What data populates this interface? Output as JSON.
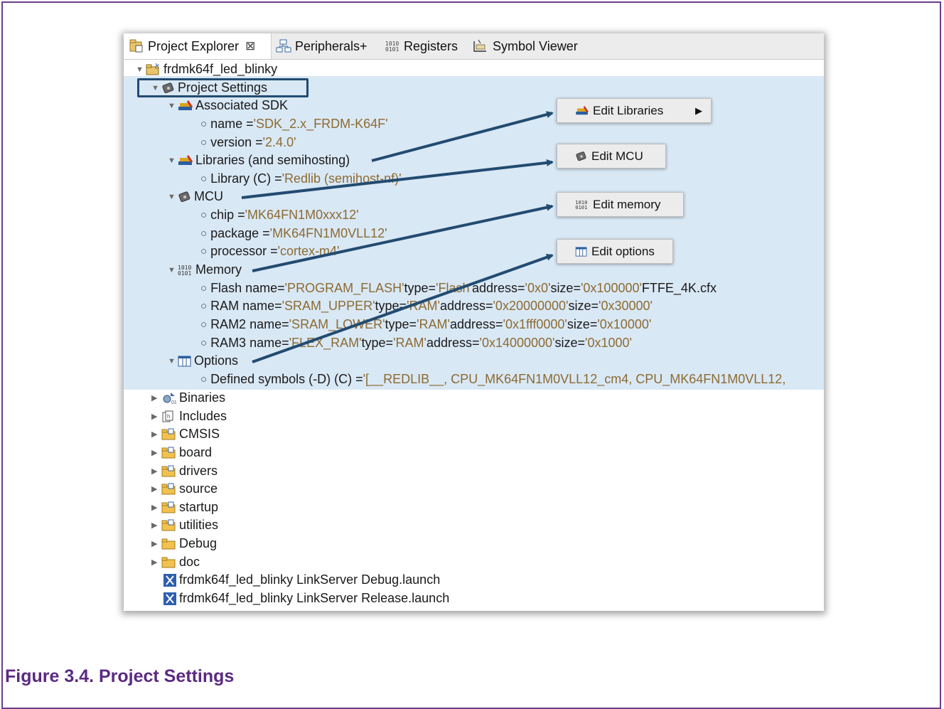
{
  "tabs": [
    {
      "label": "Project Explorer",
      "close": "⊠",
      "icon": "project-explorer-icon"
    },
    {
      "label": "Peripherals+",
      "icon": "peripherals-icon"
    },
    {
      "label": "Registers",
      "icon": "registers-icon"
    },
    {
      "label": "Symbol Viewer",
      "icon": "symbol-viewer-icon"
    }
  ],
  "tree": {
    "project": "frdmk64f_led_blinky",
    "project_settings": "Project Settings",
    "sdk": {
      "label": "Associated SDK",
      "name_key": "name = ",
      "name_val": "'SDK_2.x_FRDM-K64F'",
      "version_key": "version = ",
      "version_val": "'2.4.0'"
    },
    "libraries": {
      "label": "Libraries (and semihosting)",
      "lib_key": "Library (C) = ",
      "lib_val": "'Redlib (semihost-nf)'"
    },
    "mcu": {
      "label": "MCU",
      "chip_key": "chip = ",
      "chip_val": "'MK64FN1M0xxx12'",
      "package_key": "package = ",
      "package_val": "'MK64FN1M0VLL12'",
      "processor_key": "processor = ",
      "processor_val": "'cortex-m4'"
    },
    "memory": {
      "label": "Memory",
      "items": [
        {
          "p1": "Flash name=",
          "v1": "'PROGRAM_FLASH'",
          "p2": " type=",
          "v2": "'Flash'",
          "p3": " address=",
          "v3": "'0x0'",
          "p4": " size=",
          "v4": "'0x100000'",
          "p5": " FTFE_4K.cfx"
        },
        {
          "p1": "RAM name=",
          "v1": "'SRAM_UPPER'",
          "p2": " type=",
          "v2": "'RAM'",
          "p3": " address=",
          "v3": "'0x20000000'",
          "p4": " size=",
          "v4": "'0x30000'",
          "p5": ""
        },
        {
          "p1": "RAM2 name=",
          "v1": "'SRAM_LOWER'",
          "p2": " type=",
          "v2": "'RAM'",
          "p3": " address=",
          "v3": "'0x1fff0000'",
          "p4": " size=",
          "v4": "'0x10000'",
          "p5": ""
        },
        {
          "p1": "RAM3 name=",
          "v1": "'FLEX_RAM'",
          "p2": " type=",
          "v2": "'RAM'",
          "p3": " address=",
          "v3": "'0x14000000'",
          "p4": " size=",
          "v4": "'0x1000'",
          "p5": ""
        }
      ]
    },
    "options": {
      "label": "Options",
      "defined_key": "Defined symbols (-D) (C) = ",
      "defined_val": "'[__REDLIB__, CPU_MK64FN1M0VLL12_cm4, CPU_MK64FN1M0VLL12,"
    },
    "folders": [
      "Binaries",
      "Includes",
      "CMSIS",
      "board",
      "drivers",
      "source",
      "startup",
      "utilities",
      "Debug",
      "doc"
    ],
    "launch_files": [
      "frdmk64f_led_blinky LinkServer Debug.launch",
      "frdmk64f_led_blinky LinkServer Release.launch"
    ]
  },
  "popups": {
    "edit_libraries": "Edit Libraries",
    "edit_mcu": "Edit MCU",
    "edit_memory": "Edit memory",
    "edit_options": "Edit options"
  },
  "caption": "Figure 3.4. Project Settings",
  "colors": {
    "highlight": "#d9e8f5",
    "annotation": "#224b70",
    "value_text": "#8c6b32",
    "caption": "#5a2a82",
    "frame": "#6b3d8c"
  }
}
